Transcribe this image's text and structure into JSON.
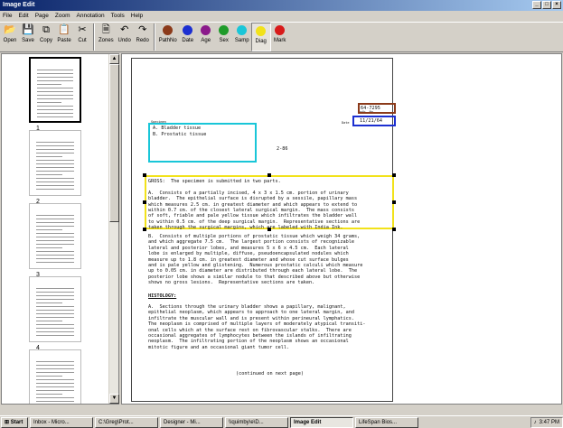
{
  "window": {
    "title": "Image Edit",
    "controls": [
      "_",
      "□",
      "×"
    ]
  },
  "menu": [
    "File",
    "Edit",
    "Page",
    "Zoom",
    "Annotation",
    "Tools",
    "Help"
  ],
  "toolbar": [
    {
      "id": "open",
      "label": "Open",
      "icon": "open-folder-icon",
      "glyph": "📂"
    },
    {
      "id": "save",
      "label": "Save",
      "icon": "floppy-disk-icon",
      "glyph": "💾"
    },
    {
      "id": "copy",
      "label": "Copy",
      "icon": "copy-icon",
      "glyph": "⧉"
    },
    {
      "id": "paste",
      "label": "Paste",
      "icon": "paste-icon",
      "glyph": "📋"
    },
    {
      "id": "cut",
      "label": "Cut",
      "icon": "scissors-icon",
      "glyph": "✂"
    },
    {
      "id": "zones",
      "label": "Zones",
      "icon": "zones-page-icon",
      "glyph": "🗎"
    },
    {
      "id": "undo",
      "label": "Undo",
      "icon": "undo-arrow-icon",
      "glyph": "↶"
    },
    {
      "id": "redo",
      "label": "Redo",
      "icon": "redo-arrow-icon",
      "glyph": "↷"
    },
    {
      "id": "pathno",
      "label": "PathNo",
      "icon": "brown-dot-icon",
      "color": "#8b3a1a"
    },
    {
      "id": "date",
      "label": "Date",
      "icon": "blue-dot-icon",
      "color": "#1c2fd1"
    },
    {
      "id": "age",
      "label": "Age",
      "icon": "purple-dot-icon",
      "color": "#8b1a8b"
    },
    {
      "id": "sex",
      "label": "Sex",
      "icon": "green-dot-icon",
      "color": "#1f9b2a"
    },
    {
      "id": "samp",
      "label": "Samp",
      "icon": "cyan-dot-icon",
      "color": "#19c6d8"
    },
    {
      "id": "diag",
      "label": "Diag",
      "icon": "yellow-dot-icon",
      "color": "#f2e21a",
      "active": true
    },
    {
      "id": "mark",
      "label": "Mark",
      "icon": "red-dot-icon",
      "color": "#d81a1a"
    }
  ],
  "thumbnails": [
    {
      "num": "1",
      "selected": true
    },
    {
      "num": "2",
      "selected": false
    },
    {
      "num": "3",
      "selected": false
    },
    {
      "num": "4",
      "selected": false
    },
    {
      "num": "",
      "selected": false
    }
  ],
  "document": {
    "path_no_label": "Path. No.",
    "path_no": "64-7295",
    "date_label": "Date",
    "date": "11/21/64",
    "specimen_label": "Specimen",
    "specimen_a": "A. Bladder tissue",
    "specimen_b": "B. Prostatic tissue",
    "small_code": "2-86",
    "gross_paragraph": "GROSS:  The specimen is submitted in two parts.\n\nA.  Consists of a partially incised, 4 x 3 x 1.5 cm. portion of urinary\nbladder.  The epithelial surface is disrupted by a sessile, papillary mass\nwhich measures 2.5 cm. in greatest diameter and which appears to extend to\nwithin 0.7 cm. of the closest lateral surgical margin.  The mass consists\nof soft, friable and pale yellow tissue which infiltrates the bladder wall\nto within 0.5 cm. of the deep surgical margin.  Representative sections are\ntaken through the surgical margins, which are labeled with India Ink.",
    "part_b_paragraph": "B.  Consists of multiple portions of prostatic tissue which weigh 34 grams,\nand which aggregate 7.5 cm.  The largest portion consists of recognizable\nlateral and posterior lobes, and measures 5 x 6 x 4.5 cm.  Each lateral\nlobe is enlarged by multiple, diffuse, pseudoencapsulated nodules which\nmeasure up to 1.8 cm. in greatest diameter and whose cut surface bulges\nand is pale yellow and glistening.  Numerous prostatic calculi which measure\nup to 0.05 cm. in diameter are distributed through each lateral lobe.  The\nposterior lobe shows a similar nodule to that described above but otherwise\nshows no gross lesions.  Representative sections are taken.",
    "histology_heading": "HISTOLOGY:",
    "histology_paragraph": "A.  Sections through the urinary bladder shows a papillary, malignant,\nepithelial neoplasm, which appears to approach to one lateral margin, and\ninfiltrate the muscular wall and is present within perineural lymphatics.\nThe neoplasm is comprised of multiple layers of moderately atypical transiti-\nonal cells which at the surface rest on fibrovascular stalks.  There are\noccasional aggregates of lymphocytes between the islands of infiltrating\nneoplasm.  The infiltrating portion of the neoplasm shows an occasional\nmitotic figure and an occasional giant tumor cell.",
    "continued": "(continued on next page)"
  },
  "colors": {
    "pathno_box": "#8b3a1a",
    "date_box": "#1c2fd1",
    "specimen_box": "#19c6d8",
    "diag_box": "#f2e21a"
  },
  "taskbar": {
    "start": "Start",
    "tasks": [
      {
        "label": "Inbox - Micro...",
        "active": false
      },
      {
        "label": "C:\\Greg\\Prot...",
        "active": false
      },
      {
        "label": "Designer - Mi...",
        "active": false
      },
      {
        "label": "\\\\quimby\\e\\D...",
        "active": false
      },
      {
        "label": "Image Edit",
        "active": true
      },
      {
        "label": "LifeSpan Bios...",
        "active": false
      }
    ],
    "clock": "3:47 PM"
  }
}
